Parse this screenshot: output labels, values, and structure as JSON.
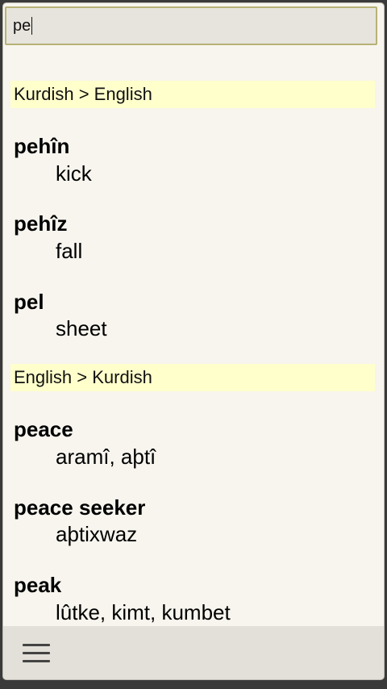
{
  "search": {
    "value": "pe"
  },
  "sections": [
    {
      "header": "Kurdish > English",
      "entries": [
        {
          "term": "pehîn",
          "translation": "kick"
        },
        {
          "term": "pehîz",
          "translation": "fall"
        },
        {
          "term": "pel",
          "translation": "sheet"
        }
      ]
    },
    {
      "header": "English > Kurdish",
      "entries": [
        {
          "term": "peace",
          "translation": "aramî, aþtî"
        },
        {
          "term": "peace seeker",
          "translation": "aþtixwaz"
        },
        {
          "term": "peak",
          "translation": "lûtke, kimt, kumbet"
        }
      ]
    }
  ],
  "icons": {
    "menu": "menu-hamburger-icon"
  }
}
